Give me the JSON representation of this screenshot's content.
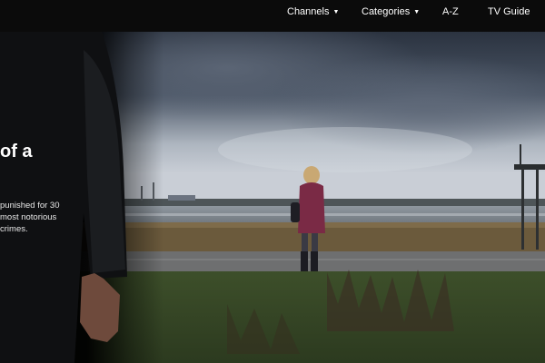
{
  "nav": {
    "items": [
      {
        "label": "Channels",
        "has_dropdown": true
      },
      {
        "label": "Categories",
        "has_dropdown": true
      },
      {
        "label": "A-Z",
        "has_dropdown": false
      },
      {
        "label": "TV Guide",
        "has_dropdown": false
      }
    ],
    "caret_glyph": "▼"
  },
  "hero": {
    "title_fragment": "of a",
    "description_lines": [
      "punished for 30",
      "most notorious",
      "crimes."
    ]
  },
  "colors": {
    "nav_background": "#0b0b0b",
    "page_background": "#000000",
    "sky": "#3f4a5a",
    "grass": "#4a6432",
    "coat": "#7a2a45"
  }
}
